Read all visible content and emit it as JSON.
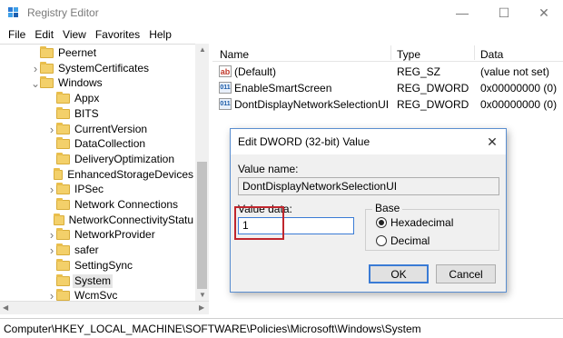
{
  "window": {
    "title": "Registry Editor",
    "minimize_glyph": "—",
    "maximize_glyph": "☐",
    "close_glyph": "✕"
  },
  "menu": [
    "File",
    "Edit",
    "View",
    "Favorites",
    "Help"
  ],
  "tree": {
    "items": [
      {
        "label": "Peernet",
        "indent": 1,
        "expander": "none"
      },
      {
        "label": "SystemCertificates",
        "indent": 1,
        "expander": "collapsed"
      },
      {
        "label": "Windows",
        "indent": 1,
        "expander": "expanded"
      },
      {
        "label": "Appx",
        "indent": 2,
        "expander": "none"
      },
      {
        "label": "BITS",
        "indent": 2,
        "expander": "none"
      },
      {
        "label": "CurrentVersion",
        "indent": 2,
        "expander": "collapsed"
      },
      {
        "label": "DataCollection",
        "indent": 2,
        "expander": "none"
      },
      {
        "label": "DeliveryOptimization",
        "indent": 2,
        "expander": "none"
      },
      {
        "label": "EnhancedStorageDevices",
        "indent": 2,
        "expander": "none"
      },
      {
        "label": "IPSec",
        "indent": 2,
        "expander": "collapsed"
      },
      {
        "label": "Network Connections",
        "indent": 2,
        "expander": "none"
      },
      {
        "label": "NetworkConnectivityStatu",
        "indent": 2,
        "expander": "none"
      },
      {
        "label": "NetworkProvider",
        "indent": 2,
        "expander": "collapsed"
      },
      {
        "label": "safer",
        "indent": 2,
        "expander": "collapsed"
      },
      {
        "label": "SettingSync",
        "indent": 2,
        "expander": "none"
      },
      {
        "label": "System",
        "indent": 2,
        "expander": "none",
        "selected": true
      },
      {
        "label": "WcmSvc",
        "indent": 2,
        "expander": "collapsed"
      }
    ]
  },
  "values": {
    "columns": [
      "Name",
      "Type",
      "Data"
    ],
    "rows": [
      {
        "icon": "string-value-icon",
        "name": "(Default)",
        "type": "REG_SZ",
        "data": "(value not set)"
      },
      {
        "icon": "dword-value-icon",
        "name": "EnableSmartScreen",
        "type": "REG_DWORD",
        "data": "0x00000000 (0)"
      },
      {
        "icon": "dword-value-icon",
        "name": "DontDisplayNetworkSelectionUI",
        "type": "REG_DWORD",
        "data": "0x00000000 (0)"
      }
    ]
  },
  "status_path": "Computer\\HKEY_LOCAL_MACHINE\\SOFTWARE\\Policies\\Microsoft\\Windows\\System",
  "dialog": {
    "title": "Edit DWORD (32-bit) Value",
    "value_name_label": "Value name:",
    "value_name": "DontDisplayNetworkSelectionUI",
    "value_data_label": "Value data:",
    "value_data": "1",
    "base_label": "Base",
    "base_options": [
      {
        "label": "Hexadecimal",
        "selected": true
      },
      {
        "label": "Decimal",
        "selected": false
      }
    ],
    "ok_label": "OK",
    "cancel_label": "Cancel",
    "close_glyph": "✕"
  },
  "colors": {
    "accent": "#3a7bd5",
    "highlight_red": "#c0262d",
    "folder": "#f3d06a"
  }
}
